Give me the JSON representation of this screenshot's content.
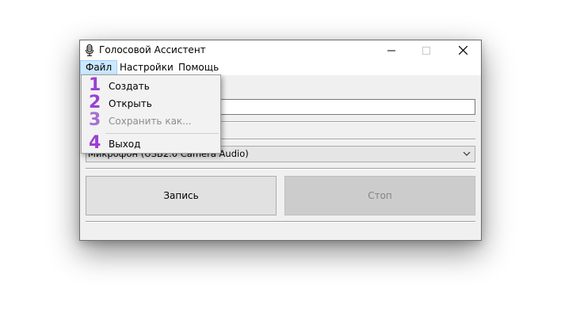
{
  "window": {
    "title": "Голосовой Ассистент",
    "icon": "microphone-icon",
    "controls": [
      "minimize-icon",
      "maximize-icon",
      "close-icon"
    ]
  },
  "menubar": {
    "file": "Файл",
    "settings": "Настройки",
    "help": "Помощь"
  },
  "file_menu": {
    "items": [
      {
        "number": "1",
        "label": "Создать",
        "enabled": true
      },
      {
        "number": "2",
        "label": "Открыть",
        "enabled": true
      },
      {
        "number": "3",
        "label": "Сохранить как...",
        "enabled": false
      },
      {
        "number": "4",
        "label": "Выход",
        "enabled": true
      }
    ]
  },
  "main": {
    "text_input_value": "",
    "microphone_select": "Микрофон (USB2.0 Camera Audio)",
    "record_button": "Запись",
    "stop_button": "Стоп"
  },
  "colors": {
    "annotation_number": "#9b3fd3",
    "menu_highlight": "#cce8ff"
  }
}
